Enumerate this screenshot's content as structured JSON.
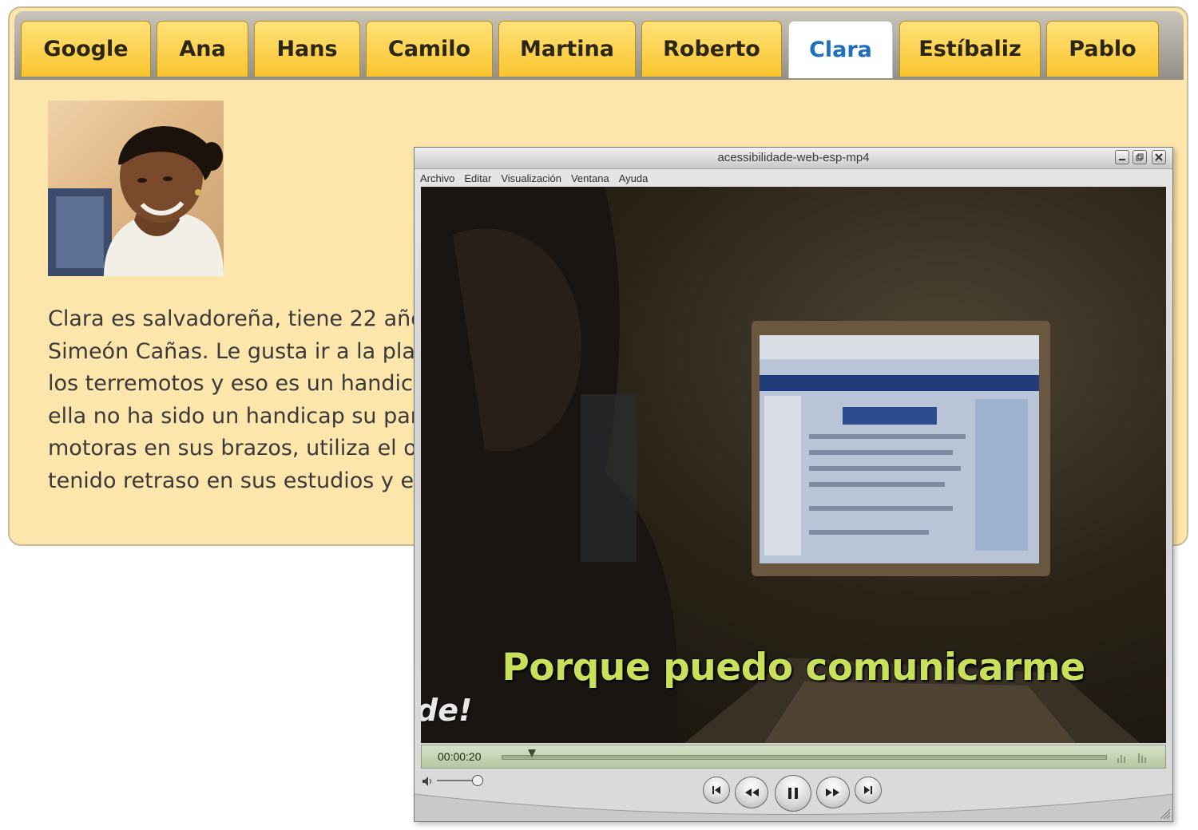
{
  "tabs": [
    {
      "label": "Google"
    },
    {
      "label": "Ana"
    },
    {
      "label": "Hans"
    },
    {
      "label": "Camilo"
    },
    {
      "label": "Martina"
    },
    {
      "label": "Roberto"
    },
    {
      "label": "Clara"
    },
    {
      "label": "Estíbaliz"
    },
    {
      "label": "Pablo"
    }
  ],
  "active_tab": "Clara",
  "profile": {
    "text_lines": [
      "Clara es salvadoreña, tiene 22 años,",
      "Simeón Cañas. Le gusta ir a la playa",
      "los terremotos y eso es un handicap",
      "ella no ha sido un handicap su pará",
      "motoras en sus brazos, utiliza el orc",
      "tenido retraso en sus estudios y es"
    ]
  },
  "player": {
    "title": "acessibilidade-web-esp-mp4",
    "menu": [
      "Archivo",
      "Editar",
      "Visualización",
      "Ventana",
      "Ayuda"
    ],
    "subtitle": "Porque puedo comunicarme",
    "left_word": "de!",
    "timecode": "00:00:20",
    "progress": 0.028
  },
  "colors": {
    "panel_bg": "#fde6ac",
    "tab_bg": "#f9c42d",
    "active_tab_text": "#1e6fc0",
    "subtitle": "#c8e05a"
  }
}
